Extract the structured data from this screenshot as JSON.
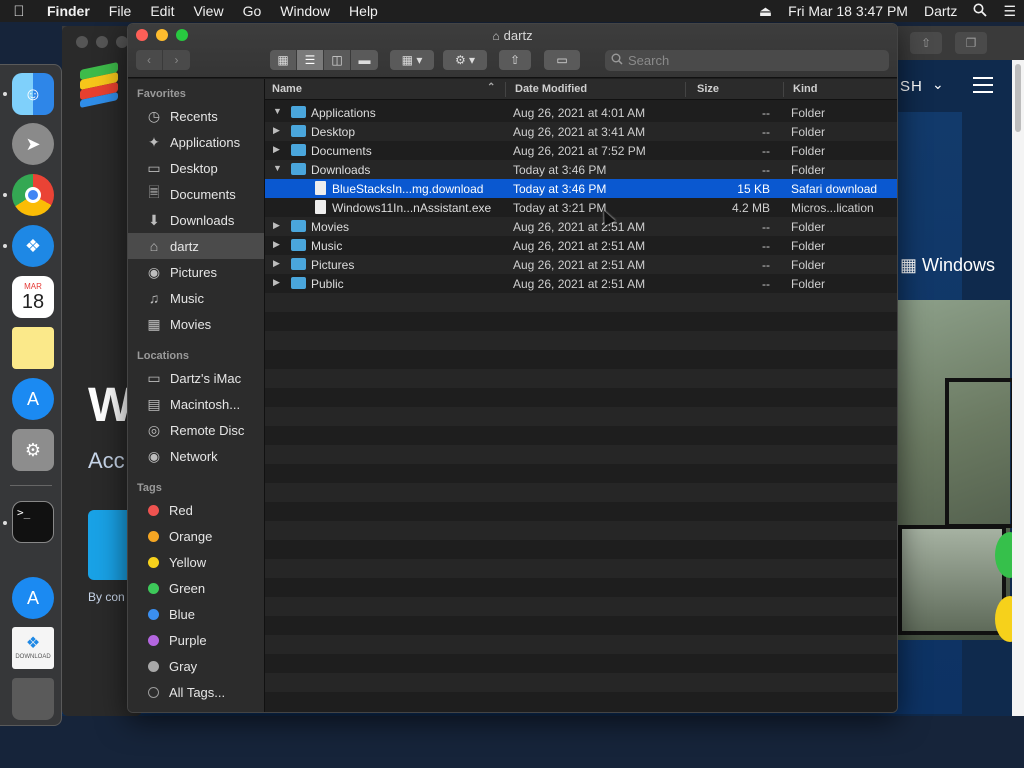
{
  "menubar": {
    "app_name": "Finder",
    "items": [
      "File",
      "Edit",
      "View",
      "Go",
      "Window",
      "Help"
    ],
    "datetime": "Fri Mar 18  3:47 PM",
    "user": "Dartz"
  },
  "background": {
    "big_text": "W",
    "sub_text": "Acc",
    "by_text": "By con",
    "nav_text": "SH",
    "windows_text": "Windows",
    "calendar_month": "MAR",
    "calendar_day": "18",
    "download_label": "DOWNLOAD",
    "terminal_prompt": ">_"
  },
  "finder": {
    "title": "dartz",
    "search_placeholder": "Search",
    "sidebar": {
      "favorites_header": "Favorites",
      "favorites": [
        {
          "label": "Recents",
          "icon": "clock-icon"
        },
        {
          "label": "Applications",
          "icon": "applications-icon"
        },
        {
          "label": "Desktop",
          "icon": "desktop-icon"
        },
        {
          "label": "Documents",
          "icon": "document-icon"
        },
        {
          "label": "Downloads",
          "icon": "download-icon"
        },
        {
          "label": "dartz",
          "icon": "home-icon",
          "selected": true
        },
        {
          "label": "Pictures",
          "icon": "camera-icon"
        },
        {
          "label": "Music",
          "icon": "music-note-icon"
        },
        {
          "label": "Movies",
          "icon": "film-icon"
        }
      ],
      "locations_header": "Locations",
      "locations": [
        {
          "label": "Dartz's iMac",
          "icon": "imac-icon"
        },
        {
          "label": "Macintosh...",
          "icon": "disk-icon"
        },
        {
          "label": "Remote Disc",
          "icon": "disc-icon"
        },
        {
          "label": "Network",
          "icon": "globe-icon"
        }
      ],
      "tags_header": "Tags",
      "tags": [
        {
          "label": "Red",
          "color": "#ef5350"
        },
        {
          "label": "Orange",
          "color": "#f5a623"
        },
        {
          "label": "Yellow",
          "color": "#f7d21c"
        },
        {
          "label": "Green",
          "color": "#3dc95a"
        },
        {
          "label": "Blue",
          "color": "#3b8ff0"
        },
        {
          "label": "Purple",
          "color": "#b466e0"
        },
        {
          "label": "Gray",
          "color": "#a8a8a8"
        },
        {
          "label": "All Tags...",
          "color": ""
        }
      ]
    },
    "columns": {
      "name": "Name",
      "date": "Date Modified",
      "size": "Size",
      "kind": "Kind"
    },
    "rows": [
      {
        "name": "Applications",
        "date": "Aug 26, 2021 at 4:01 AM",
        "size": "--",
        "kind": "Folder",
        "type": "folder",
        "expanded": true,
        "depth": 0
      },
      {
        "name": "Desktop",
        "date": "Aug 26, 2021 at 3:41 AM",
        "size": "--",
        "kind": "Folder",
        "type": "folder",
        "expanded": false,
        "depth": 0
      },
      {
        "name": "Documents",
        "date": "Aug 26, 2021 at 7:52 PM",
        "size": "--",
        "kind": "Folder",
        "type": "folder",
        "expanded": false,
        "depth": 0
      },
      {
        "name": "Downloads",
        "date": "Today at 3:46 PM",
        "size": "--",
        "kind": "Folder",
        "type": "folder",
        "expanded": true,
        "depth": 0
      },
      {
        "name": "BlueStacksIn...mg.download",
        "date": "Today at 3:46 PM",
        "size": "15 KB",
        "kind": "Safari download",
        "type": "file",
        "depth": 1,
        "selected": true
      },
      {
        "name": "Windows11In...nAssistant.exe",
        "date": "Today at 3:21 PM",
        "size": "4.2 MB",
        "kind": "Micros...lication",
        "type": "file",
        "depth": 1
      },
      {
        "name": "Movies",
        "date": "Aug 26, 2021 at 2:51 AM",
        "size": "--",
        "kind": "Folder",
        "type": "folder",
        "expanded": false,
        "depth": 0
      },
      {
        "name": "Music",
        "date": "Aug 26, 2021 at 2:51 AM",
        "size": "--",
        "kind": "Folder",
        "type": "folder",
        "expanded": false,
        "depth": 0
      },
      {
        "name": "Pictures",
        "date": "Aug 26, 2021 at 2:51 AM",
        "size": "--",
        "kind": "Folder",
        "type": "folder",
        "expanded": false,
        "depth": 0
      },
      {
        "name": "Public",
        "date": "Aug 26, 2021 at 2:51 AM",
        "size": "--",
        "kind": "Folder",
        "type": "folder",
        "expanded": false,
        "depth": 0
      }
    ]
  },
  "colors": {
    "selection": "#0a58d0",
    "folder": "#4aa6dc"
  }
}
